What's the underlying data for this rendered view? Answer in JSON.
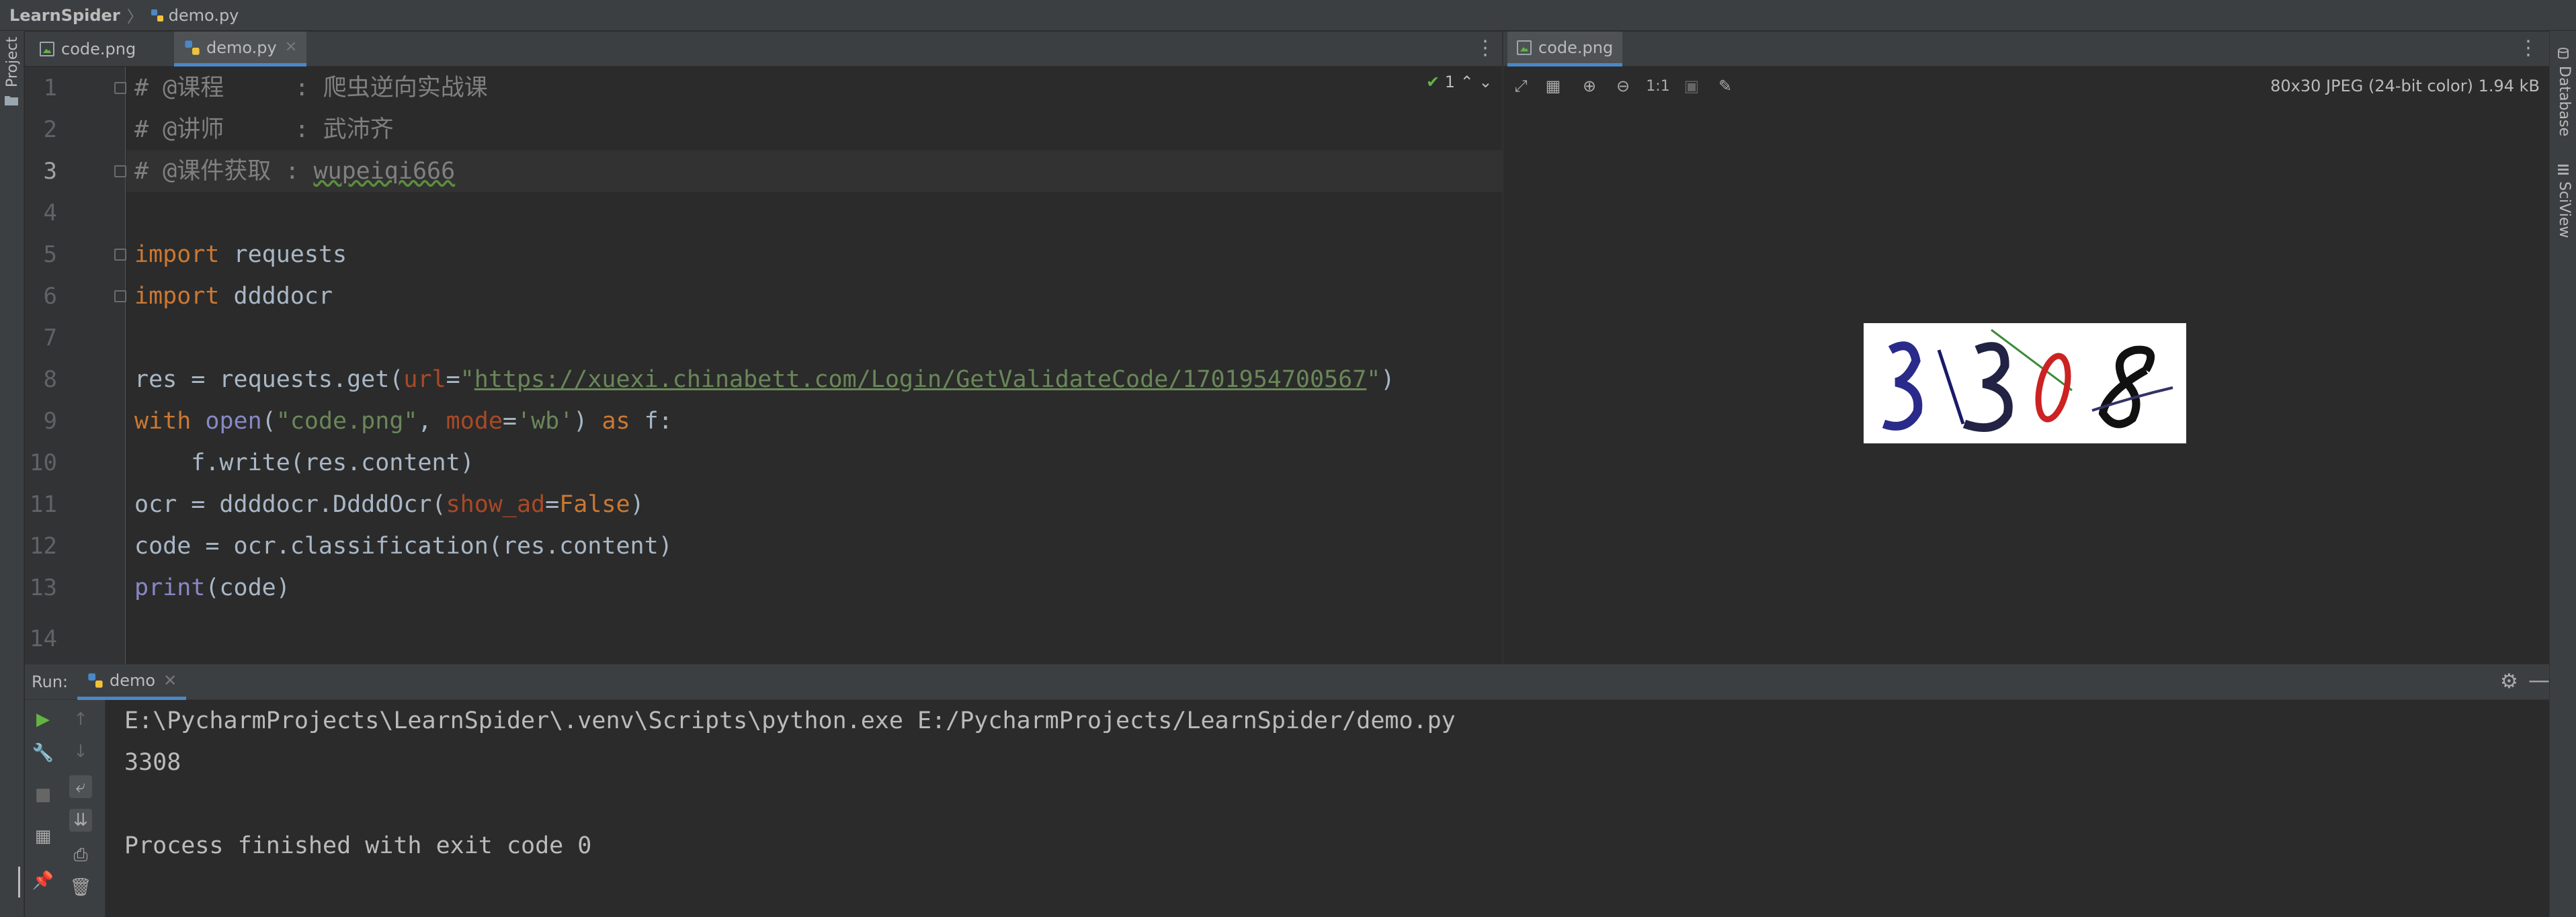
{
  "breadcrumb": {
    "project": "LearnSpider",
    "file": "demo.py"
  },
  "left_strip": {
    "project_label": "Project"
  },
  "right_strip": {
    "database_label": "Database",
    "sciview_label": "SciView"
  },
  "editor_tabs": [
    {
      "label": "code.png",
      "active": false
    },
    {
      "label": "demo.py",
      "active": true
    }
  ],
  "inspection": {
    "count": "1"
  },
  "code_lines": [
    {
      "no": "1",
      "text": "# @课程     : 爬虫逆向实战课"
    },
    {
      "no": "2",
      "text": "# @讲师     : 武沛齐"
    },
    {
      "no": "3",
      "text_a": "# @课件获取 : ",
      "text_b": "wupeiqi666"
    },
    {
      "no": "4"
    },
    {
      "no": "5",
      "kw": "import",
      "rest": " requests"
    },
    {
      "no": "6",
      "kw": "import",
      "rest": " ddddocr"
    },
    {
      "no": "7"
    },
    {
      "no": "8",
      "a": "res = requests.get(",
      "p": "url",
      "eq": "=",
      "q1": "\"",
      "url": "https://xuexi.chinabett.com/Login/GetValidateCode/1701954700567",
      "q2": "\"",
      "close": ")"
    },
    {
      "no": "9",
      "kw": "with",
      "sp": " ",
      "bi": "open",
      "p1": "(",
      "s1": "\"code.png\"",
      "c": ", ",
      "pm": "mode",
      "eq": "=",
      "s2": "'wb'",
      "p2": ") ",
      "kw2": "as",
      "rest": " f:"
    },
    {
      "no": "10",
      "text": "    f.write(res.content)"
    },
    {
      "no": "11",
      "a": "ocr = ddddocr.DdddOcr(",
      "pm": "show_ad",
      "eq": "=",
      "kw": "False",
      "close": ")"
    },
    {
      "no": "12",
      "text": "code = ocr.classification(res.content)"
    },
    {
      "no": "13",
      "bi": "print",
      "rest": "(code)"
    },
    {
      "no": "14"
    }
  ],
  "image_viewer": {
    "tab_label": "code.png",
    "zoom_label": "1:1",
    "info": "80x30 JPEG (24-bit color) 1.94 kB"
  },
  "run_panel": {
    "label": "Run:",
    "tab_label": "demo",
    "output": [
      "E:\\PycharmProjects\\LearnSpider\\.venv\\Scripts\\python.exe E:/PycharmProjects/LearnSpider/demo.py",
      "3308",
      "",
      "Process finished with exit code 0"
    ]
  },
  "colors": {
    "accent": "#4a88c7",
    "keyword": "#cc7832",
    "string": "#6a8759",
    "comment": "#808080",
    "param": "#aa4926",
    "builtin": "#8888c6",
    "run_green": "#62b543"
  }
}
